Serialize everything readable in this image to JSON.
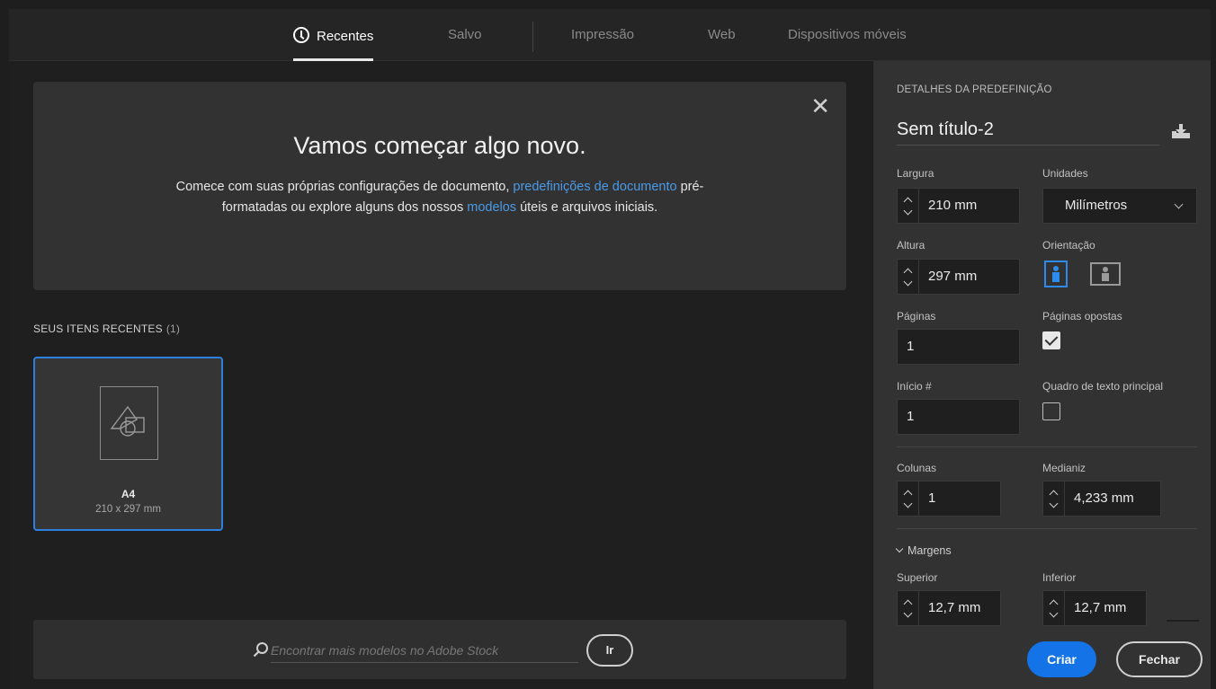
{
  "tabs": [
    {
      "label": "Recentes",
      "active": true
    },
    {
      "label": "Salvo"
    },
    {
      "label": "Impressão"
    },
    {
      "label": "Web"
    },
    {
      "label": "Dispositivos móveis"
    }
  ],
  "welcome": {
    "title": "Vamos começar algo novo.",
    "text_1": "Comece com suas próprias configurações de documento, ",
    "link_presets": "predefinições de documento",
    "text_2": " pré-formatadas ou explore alguns dos nossos ",
    "link_templates": "modelos",
    "text_3": " úteis e arquivos iniciais.",
    "close_icon": "close-icon"
  },
  "recent": {
    "label": "SEUS ITENS RECENTES",
    "count": "(1)",
    "items": [
      {
        "name": "A4",
        "size": "210 x 297 mm",
        "icon": "document-shapes-icon"
      }
    ]
  },
  "search": {
    "placeholder": "Encontrar mais modelos no Adobe Stock",
    "go_label": "Ir",
    "icon": "search-icon"
  },
  "preset": {
    "section_title": "DETALHES DA PREDEFINIÇÃO",
    "name": "Sem título-2",
    "save_icon": "save-preset-icon",
    "width_label": "Largura",
    "width_value": "210 mm",
    "units_label": "Unidades",
    "units_value": "Milímetros",
    "height_label": "Altura",
    "height_value": "297 mm",
    "orientation_label": "Orientação",
    "orientation_selected": "portrait",
    "pages_label": "Páginas",
    "pages_value": "1",
    "facing_label": "Páginas opostas",
    "facing_checked": true,
    "start_label": "Início #",
    "start_value": "1",
    "primary_frame_label": "Quadro de texto principal",
    "primary_frame_checked": false,
    "columns_label": "Colunas",
    "columns_value": "1",
    "gutter_label": "Medianiz",
    "gutter_value": "4,233 mm",
    "margins_label": "Margens",
    "top_label": "Superior",
    "top_value": "12,7 mm",
    "bottom_label": "Inferior",
    "bottom_value": "12,7 mm"
  },
  "actions": {
    "create_label": "Criar",
    "close_label": "Fechar"
  },
  "colors": {
    "accent": "#1473e6",
    "link": "#4a9ae8",
    "card_border": "#2d7fe0"
  }
}
